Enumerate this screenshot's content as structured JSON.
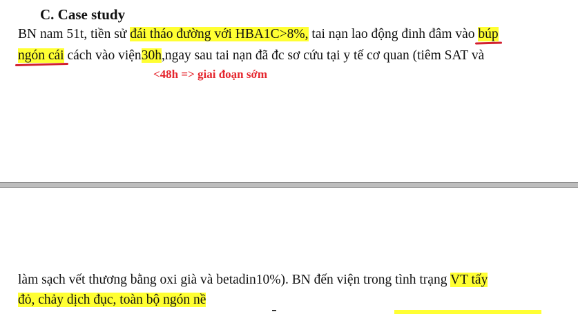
{
  "heading": "C. Case study",
  "line1": {
    "a": "BN nam 51t, tiền sử ",
    "hl": "đái tháo đường với HBA1C>8%,",
    "b": " tai nạn lao động đinh đâm vào ",
    "ul": "búp"
  },
  "line2": {
    "ul": "ngón cái",
    "a": " cách vào viện",
    "hl": "30h",
    "b": ",ngay sau tai nạn đã  đc sơ cứu tại y tế cơ quan (tiêm SAT và"
  },
  "annotation": "<48h => giai đoạn sớm",
  "line3": {
    "a": "làm sạch vết thương bằng oxi già và betadin10%). BN đến viện trong tình trạng ",
    "hl": "VT tấy"
  },
  "line4": {
    "hl": "đỏ, chảy dịch đục, toàn bộ ngón nề"
  },
  "colors": {
    "highlight": "#ffff33",
    "annotation": "#e5262e",
    "underline": "#d2202f",
    "page_gap": "#bdbdbd"
  }
}
